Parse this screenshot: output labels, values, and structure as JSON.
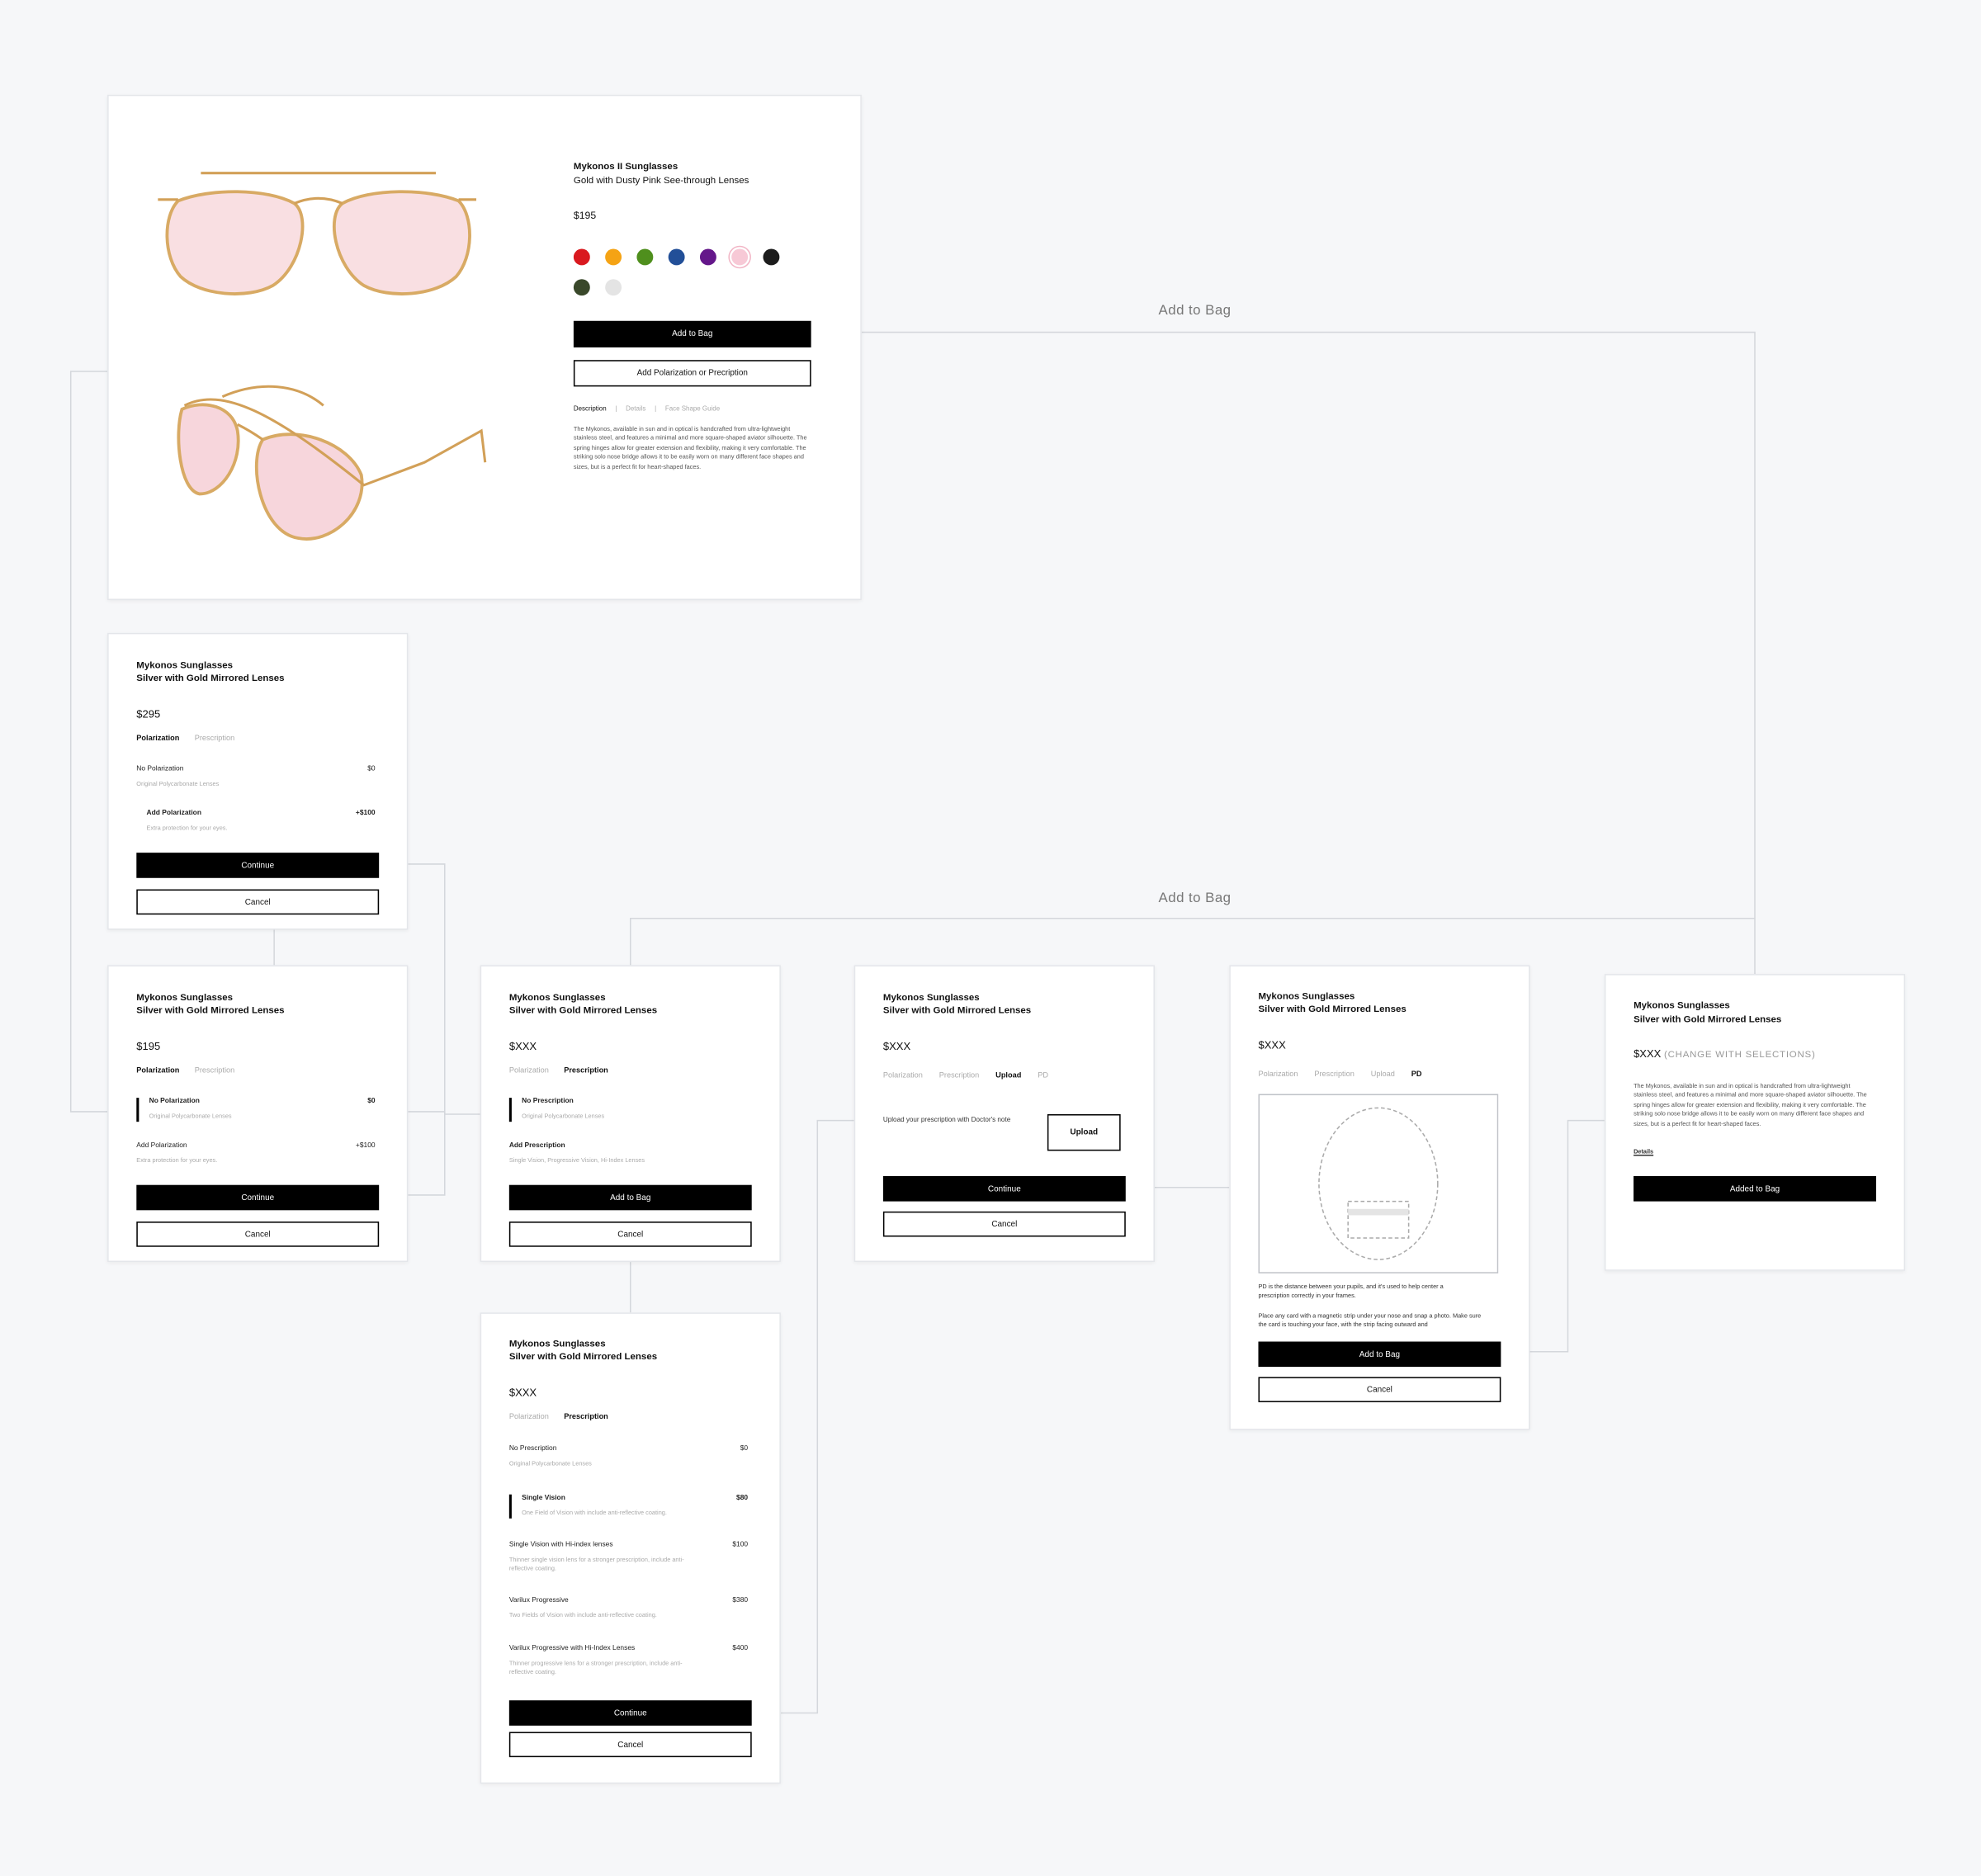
{
  "flow_labels": {
    "top": "Add to Bag",
    "middle": "Add to Bag"
  },
  "product": {
    "title": "Mykonos II Sunglasses",
    "subtitle": "Gold with Dusty Pink See-through Lenses",
    "price": "$195",
    "add_to_bag": "Add to Bag",
    "add_polarization": "Add Polarization or Precription",
    "tabs": [
      "Description",
      "Details",
      "Face Shape Guide"
    ],
    "description": "The Mykonos, available in sun and in optical is handcrafted from ultra-lightweight stainless steel, and features a minimal and more square-shaped aviator silhouette. The spring hinges allow for greater extension and flexibility, making it very comfortable. The striking solo nose bridge allows it to be easily worn on many different face shapes and sizes, but is a perfect fit for heart-shaped faces.",
    "swatches": [
      "#d9191f",
      "#f5a314",
      "#4f8f1d",
      "#224f98",
      "#64178a",
      "#f7c9d6",
      "#1c1c1c",
      "#39482a",
      "#e4e4e4"
    ]
  },
  "card1": {
    "title": "Mykonos Sunglasses",
    "subtitle": "Silver with Gold Mirrored Lenses",
    "price": "$295",
    "tabs": [
      "Polarization",
      "Prescription"
    ],
    "opt1_name": "No Polarization",
    "opt1_val": "$0",
    "opt1_desc": "Original Polycarbonate Lenses",
    "opt2_name": "Add Polarization",
    "opt2_val": "+$100",
    "opt2_desc": "Extra protection for your eyes.",
    "continue": "Continue",
    "cancel": "Cancel"
  },
  "card2": {
    "title": "Mykonos Sunglasses",
    "subtitle": "Silver with Gold Mirrored Lenses",
    "price": "$195",
    "tabs": [
      "Polarization",
      "Prescription"
    ],
    "opt1_name": "No Polarization",
    "opt1_val": "$0",
    "opt1_desc": "Original Polycarbonate Lenses",
    "opt2_name": "Add Polarization",
    "opt2_val": "+$100",
    "opt2_desc": "Extra protection for your eyes.",
    "continue": "Continue",
    "cancel": "Cancel"
  },
  "card3": {
    "title": "Mykonos Sunglasses",
    "subtitle": "Silver with Gold Mirrored Lenses",
    "price": "$XXX",
    "tabs": [
      "Polarization",
      "Prescription"
    ],
    "opt1_name": "No Prescription",
    "opt1_desc": "Original Polycarbonate Lenses",
    "opt2_name": "Add Prescription",
    "opt2_desc": "Single Vision, Progressive Vision, Hi-Index Lenses",
    "add_to_bag": "Add to Bag",
    "cancel": "Cancel"
  },
  "card4": {
    "title": "Mykonos Sunglasses",
    "subtitle": "Silver with Gold Mirrored Lenses",
    "price": "$XXX",
    "tabs": [
      "Polarization",
      "Prescription"
    ],
    "options": [
      {
        "name": "No Prescription",
        "val": "$0",
        "desc": "Original Polycarbonate Lenses"
      },
      {
        "name": "Single Vision",
        "val": "$80",
        "desc": "One Field of Vision with include anti-reflective coating."
      },
      {
        "name": "Single Vision with Hi-index lenses",
        "val": "$100",
        "desc": "Thinner single vision lens for a stronger prescription, include anti-reflective coating."
      },
      {
        "name": "Varilux Progressive",
        "val": "$380",
        "desc": "Two Fields of Vision with include anti-reflective coating."
      },
      {
        "name": "Varilux Progressive with Hi-Index Lenses",
        "val": "$400",
        "desc": "Thinner progressive lens for a stronger prescription, include anti-reflective coating."
      }
    ],
    "continue": "Continue",
    "cancel": "Cancel"
  },
  "card5": {
    "title": "Mykonos Sunglasses",
    "subtitle": "Silver with Gold Mirrored Lenses",
    "price": "$XXX",
    "tabs": [
      "Polarization",
      "Prescription",
      "Upload",
      "PD"
    ],
    "upload_text": "Upload your prescription with Doctor's note",
    "upload_button": "Upload",
    "continue": "Continue",
    "cancel": "Cancel"
  },
  "card6": {
    "title": "Mykonos Sunglasses",
    "subtitle": "Silver with Gold Mirrored Lenses",
    "price": "$XXX",
    "tabs": [
      "Polarization",
      "Prescription",
      "Upload",
      "PD"
    ],
    "pd_text1": "PD is the distance between your pupils, and it's used to help center a prescription correctly in your frames.",
    "pd_text2": "Place any card with a magnetic strip under your nose and snap a photo. Make sure the card is touching your face, with the strip facing outward and",
    "add_to_bag": "Add to Bag",
    "cancel": "Cancel"
  },
  "card7": {
    "title": "Mykonos Sunglasses",
    "subtitle": "Silver with Gold Mirrored Lenses",
    "price": "$XXX",
    "price_note": "(CHANGE WITH SELECTIONS)",
    "description": "The Mykonos, available in sun and in optical is handcrafted from ultra-lightweight stainless steel, and features a minimal and more square-shaped aviator silhouette. The spring hinges allow for greater extension and flexibility, making it very comfortable. The striking solo nose bridge allows it to be easily worn on many different face shapes and sizes, but is a perfect fit for heart-shaped faces.",
    "details_link": "Details",
    "added": "Added to Bag"
  }
}
